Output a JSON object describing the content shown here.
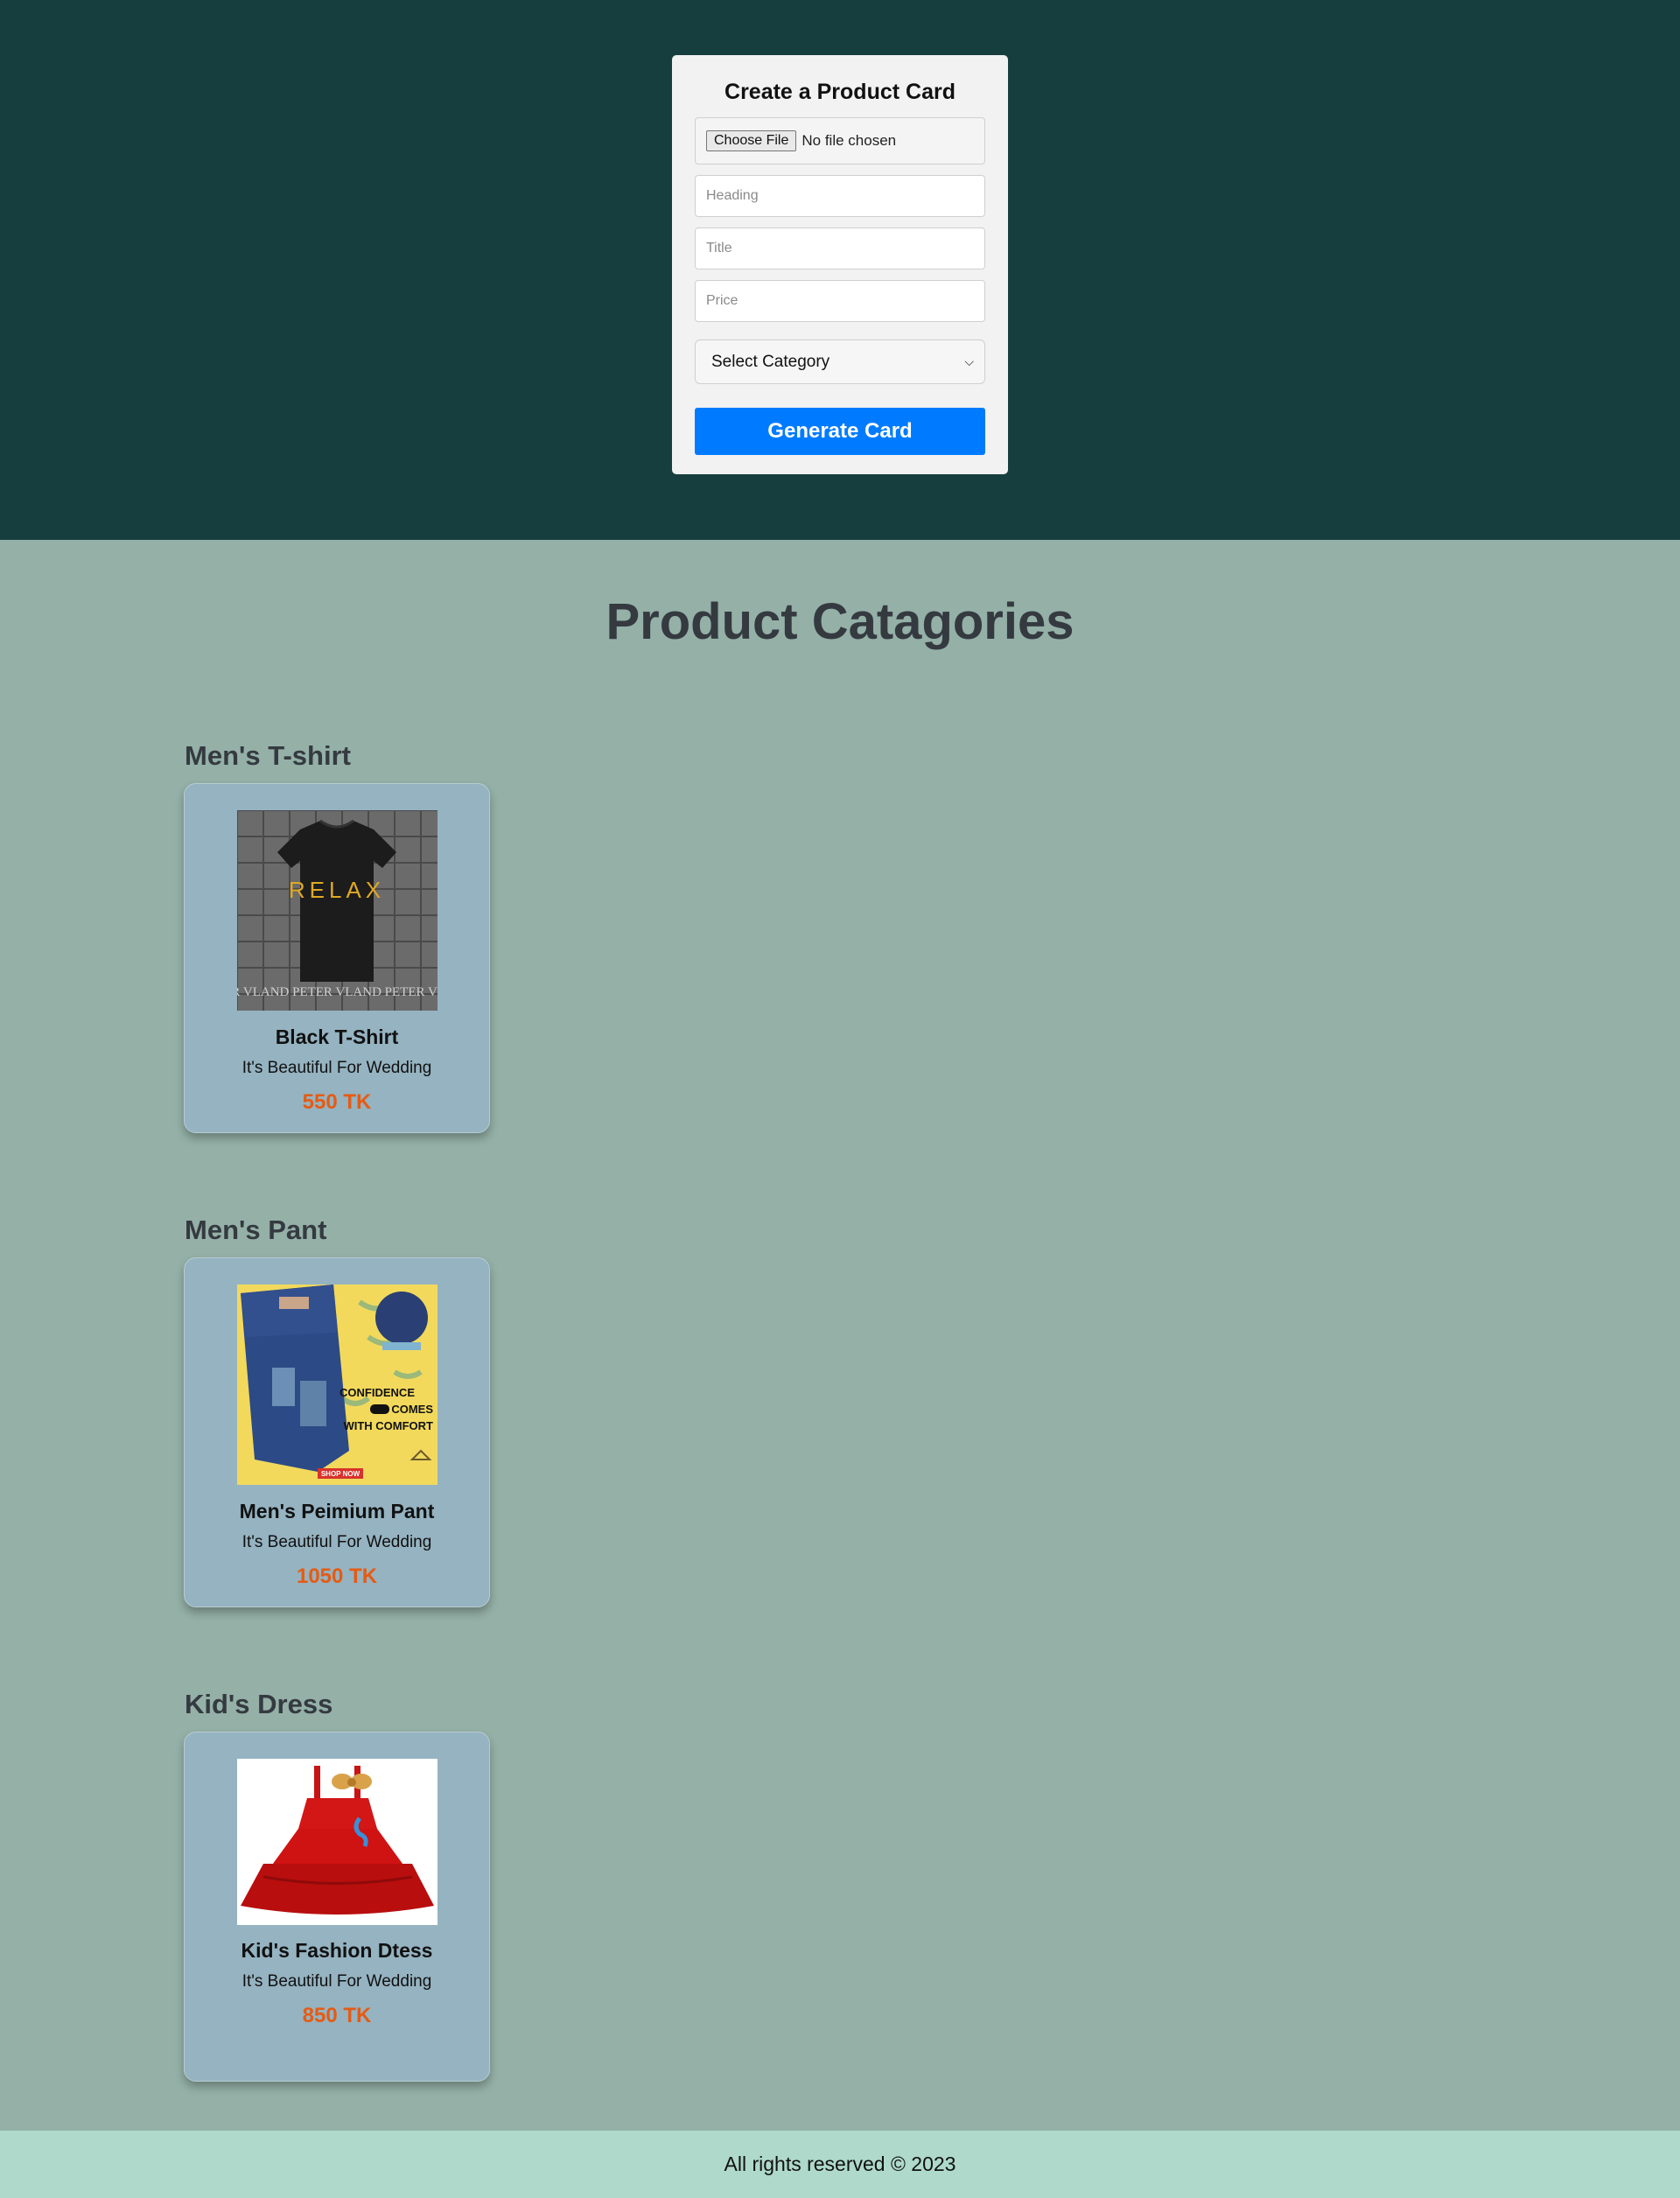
{
  "form": {
    "title": "Create a Product Card",
    "file_button": "Choose File",
    "file_status": "No file chosen",
    "heading_placeholder": "Heading",
    "title_placeholder": "Title",
    "price_placeholder": "Price",
    "category_selected": "Select Category",
    "generate_button": "Generate Card"
  },
  "page": {
    "title": "Product Catagories"
  },
  "sections": [
    {
      "heading": "Men's T-shirt",
      "product": {
        "name": "Black T-Shirt",
        "title": "It's Beautiful For Wedding",
        "price": "550 TK",
        "image_text": "RELAX",
        "image_brand": "PETER VLAND PETER VLAND PETER VLAND"
      }
    },
    {
      "heading": "Men's Pant",
      "product": {
        "name": "Men's Peimium Pant",
        "title": "It's Beautiful For Wedding",
        "price": "1050 TK",
        "image_text_1": "CONFIDENCE",
        "image_text_2": "COMES",
        "image_text_3": "WITH COMFORT",
        "image_shop": "SHOP NOW"
      }
    },
    {
      "heading": "Kid's Dress",
      "product": {
        "name": "Kid's Fashion Dtess",
        "title": "It's Beautiful For Wedding",
        "price": "850 TK"
      }
    }
  ],
  "footer": {
    "text": "All rights reserved © 2023"
  },
  "colors": {
    "hero_bg": "#173e3f",
    "page_bg": "#94b0a7",
    "card_bg": "#95b3c1",
    "button": "#007bff",
    "price": "#e55b13",
    "footer_bg": "#aed9cb"
  }
}
